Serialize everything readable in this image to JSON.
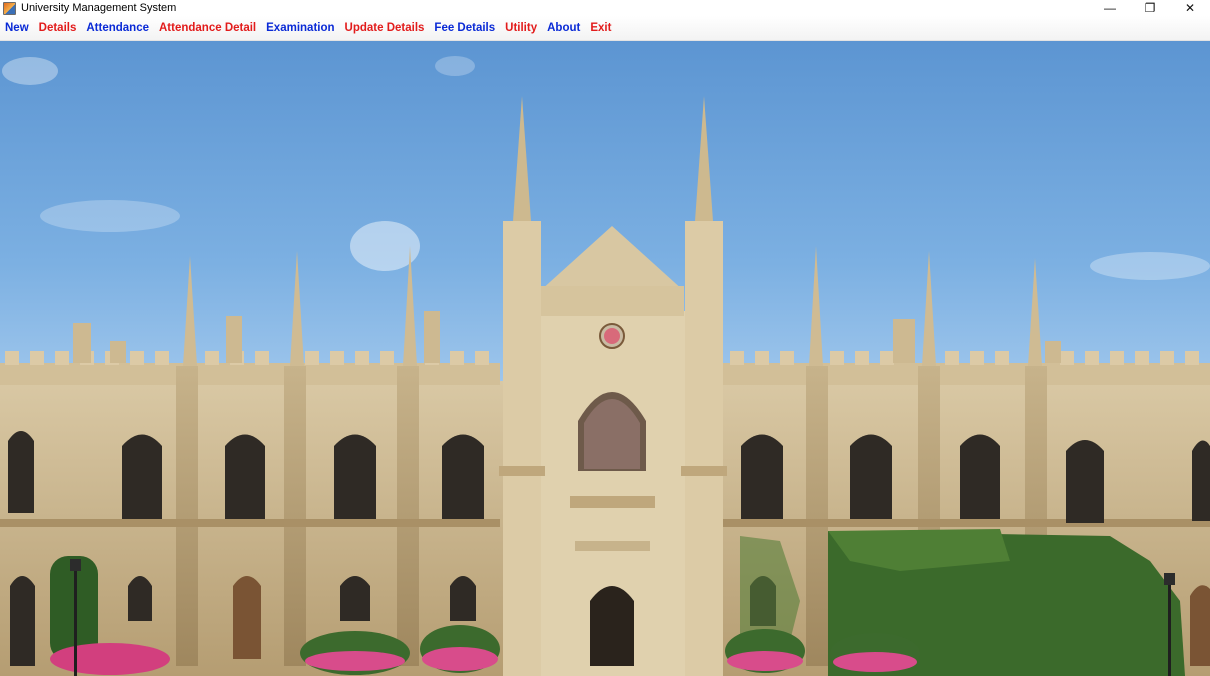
{
  "window": {
    "title": "University Management System",
    "controls": {
      "minimize": "—",
      "restore": "❐",
      "close": "✕"
    }
  },
  "menu": [
    {
      "label": "New",
      "color": "#0a2ad6"
    },
    {
      "label": "Details",
      "color": "#e21b1b"
    },
    {
      "label": "Attendance",
      "color": "#0a2ad6"
    },
    {
      "label": "Attendance Detail",
      "color": "#e21b1b"
    },
    {
      "label": "Examination",
      "color": "#0a2ad6"
    },
    {
      "label": "Update Details",
      "color": "#e21b1b"
    },
    {
      "label": "Fee Details",
      "color": "#0a2ad6"
    },
    {
      "label": "Utility",
      "color": "#e21b1b"
    },
    {
      "label": "About",
      "color": "#0a2ad6"
    },
    {
      "label": "Exit",
      "color": "#e21b1b"
    }
  ],
  "background_image": {
    "subject": "gothic-university-building-photo"
  }
}
